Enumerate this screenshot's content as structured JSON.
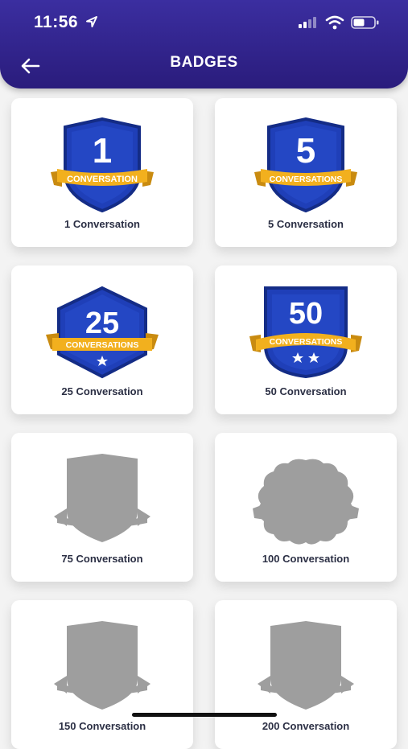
{
  "status_bar": {
    "time": "11:56"
  },
  "header": {
    "title": "BADGES"
  },
  "badges": [
    {
      "label": "1 Conversation",
      "number": "1",
      "ribbon": "CONVERSATION",
      "earned": true
    },
    {
      "label": "5 Conversation",
      "number": "5",
      "ribbon": "CONVERSATIONS",
      "earned": true
    },
    {
      "label": "25 Conversation",
      "number": "25",
      "ribbon": "CONVERSATIONS",
      "earned": true
    },
    {
      "label": "50 Conversation",
      "number": "50",
      "ribbon": "CONVERSATIONS",
      "earned": true
    },
    {
      "label": "75 Conversation",
      "earned": false
    },
    {
      "label": "100 Conversation",
      "earned": false
    },
    {
      "label": "150 Conversation",
      "earned": false
    },
    {
      "label": "200 Conversation",
      "earned": false
    }
  ],
  "colors": {
    "header": "#2e208a",
    "badge_blue": "#1f3fb8",
    "badge_blue_dark": "#152c86",
    "ribbon_gold": "#f2b01e",
    "locked_gray": "#9e9e9e"
  }
}
